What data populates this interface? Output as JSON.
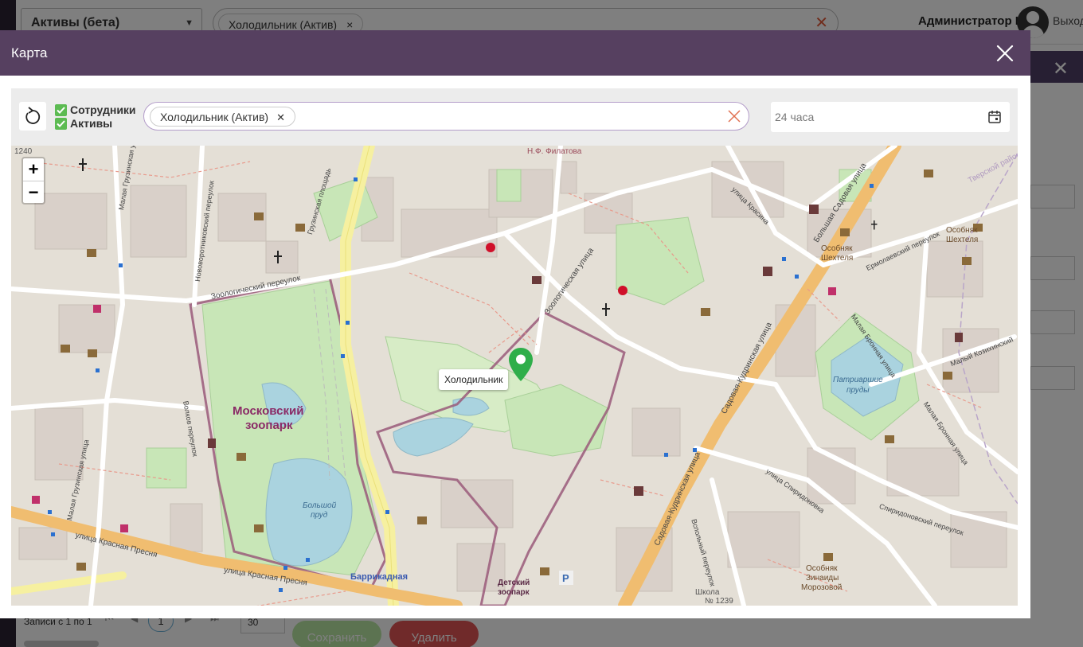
{
  "background": {
    "asset_select": "Активы (бета)",
    "filter_chip": "Холодильник (Актив)",
    "user_name": "Администратор I.",
    "exit_label": "Выход",
    "pager_text": "Записи с 1 по 1",
    "current_page": "1",
    "per_page": "30",
    "save_label": "Сохранить",
    "delete_label": "Удалить"
  },
  "modal": {
    "title": "Карта",
    "toolbar": {
      "checkboxes": [
        {
          "label": "Сотрудники",
          "checked": true
        },
        {
          "label": "Активы",
          "checked": true
        }
      ],
      "filter_chip": "Холодильник (Актив)",
      "date_range": "24 часа"
    },
    "map": {
      "zoom_in": "+",
      "zoom_out": "−",
      "marker_label": "Холодильник",
      "marker_color": "#2fae4a",
      "labels": {
        "zoo": "Московский",
        "zoo2": "зоопарк",
        "pond": "Большой",
        "pond2": "пруд",
        "patriarch": "Патриаршие",
        "patriarch2": "пруды",
        "metro": "Баррикадная",
        "filatova": "Н.Ф. Филатова",
        "kids_zoo": "Детский",
        "kids_zoo2": "зоопарк",
        "shekhtel": "Особняк",
        "shekhtel2": "Шехтеля",
        "shekhtel_b": "Особняк",
        "shekhtel_b2": "Шехтеля",
        "morozova": "Особняк",
        "morozova2": "Зинаиды",
        "morozova3": "Морозовой",
        "school": "Школа",
        "school2": "№ 1239",
        "num_1240": "1240",
        "tverskoy": "Тверской район",
        "st_krasnaya1": "улица Красная Пресня",
        "st_krasnaya2": "улица Красная Пресня",
        "st_sadovaya_kudr": "Садовая-Кудринская улица",
        "st_sadovaya_kudr2": "Садовая-Кудринская улица",
        "st_b_sadovaya": "Большая Садовая улица",
        "st_zoolog": "Зоологическая улица",
        "st_zoolog_per": "Зоологический переулок",
        "st_m_gruz": "Малая Грузинская улица",
        "st_m_gruz2": "Малая Грузинская улица",
        "st_novovag": "Нововоротниковский переулок",
        "st_volkov": "Волков переулок",
        "st_gruz_pl": "Грузинская площадь",
        "st_krasina": "улица Красина",
        "st_ermol": "Ермолаевский переулок",
        "st_m_bron": "Малая Бронная улица",
        "st_m_bron2": "Малая Бронная улица",
        "st_m_kozikh": "Малый Козихинский",
        "st_spirid": "улица Спиридоновка",
        "st_spirid_per": "Спиридоновский переулок",
        "st_vspol": "Вспольный переулок",
        "parking": "P"
      }
    }
  }
}
